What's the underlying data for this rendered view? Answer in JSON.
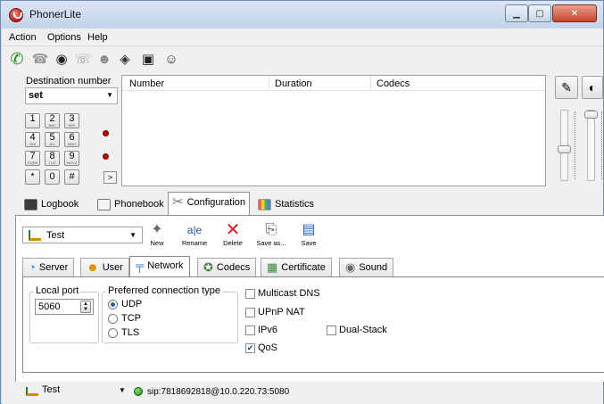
{
  "window": {
    "title": "PhonerLite"
  },
  "menu": [
    "Action",
    "Options",
    "Help"
  ],
  "toolbar": [
    {
      "icon": "call-green-handset-icon",
      "glyph": "✆",
      "color": "#1c8a1c"
    },
    {
      "icon": "hangup-handset-icon",
      "glyph": "☎",
      "color": "#9a9a9a"
    },
    {
      "icon": "voicemail-icon",
      "glyph": "◉",
      "color": "#222"
    },
    {
      "icon": "transfer-handset-icon",
      "glyph": "☏",
      "color": "#9a9a9a"
    },
    {
      "icon": "conference-users-icon",
      "glyph": "☻",
      "color": "#888"
    },
    {
      "icon": "redirect-diamond-icon",
      "glyph": "◈",
      "color": "#333"
    },
    {
      "icon": "mobile-phone-icon",
      "glyph": "▣",
      "color": "#222"
    },
    {
      "icon": "smiley-icon",
      "glyph": "☺",
      "color": "#333"
    }
  ],
  "dialer": {
    "destination_label": "Destination number",
    "destination_value": "set",
    "keys": [
      {
        "d": "1",
        "l": ""
      },
      {
        "d": "2",
        "l": "ABC"
      },
      {
        "d": "3",
        "l": "DEF"
      },
      {
        "d": "4",
        "l": "GHI"
      },
      {
        "d": "5",
        "l": "JKL"
      },
      {
        "d": "6",
        "l": "MNO"
      },
      {
        "d": "7",
        "l": "PQRS"
      },
      {
        "d": "8",
        "l": "TUV"
      },
      {
        "d": "9",
        "l": "WXYZ"
      },
      {
        "d": "*",
        "l": ""
      },
      {
        "d": "0",
        "l": ""
      },
      {
        "d": "#",
        "l": ""
      }
    ],
    "expand_label": ">"
  },
  "calllist": {
    "columns": [
      "Number",
      "Duration",
      "Codecs"
    ]
  },
  "main_tabs": [
    {
      "label": "Logbook",
      "icon": "logbook-icon"
    },
    {
      "label": "Phonebook",
      "icon": "phonebook-icon"
    },
    {
      "label": "Configuration",
      "icon": "tools-icon",
      "active": true
    },
    {
      "label": "Statistics",
      "icon": "statistics-icon"
    }
  ],
  "profile": {
    "selected": "Test",
    "buttons": [
      {
        "label": "New",
        "icon": "wand-icon",
        "glyph": "✦"
      },
      {
        "label": "Rename",
        "icon": "rename-icon",
        "glyph": "a|e"
      },
      {
        "label": "Delete",
        "icon": "delete-x-icon",
        "glyph": "✕"
      },
      {
        "label": "Save as...",
        "icon": "save-as-icon",
        "glyph": "⎘"
      },
      {
        "label": "Save",
        "icon": "save-disk-icon",
        "glyph": "▤"
      }
    ]
  },
  "config_tabs": [
    {
      "label": "Server",
      "icon": "server-icon"
    },
    {
      "label": "User",
      "icon": "user-icon"
    },
    {
      "label": "Network",
      "icon": "network-icon",
      "active": true
    },
    {
      "label": "Codecs",
      "icon": "codecs-icon"
    },
    {
      "label": "Certificate",
      "icon": "certificate-icon"
    },
    {
      "label": "Sound",
      "icon": "sound-icon"
    }
  ],
  "network": {
    "local_port_label": "Local port",
    "local_port_value": "5060",
    "conn_type_label": "Preferred connection type",
    "conn_types": [
      {
        "label": "UDP",
        "selected": true
      },
      {
        "label": "TCP",
        "selected": false
      },
      {
        "label": "TLS",
        "selected": false
      }
    ],
    "options": [
      {
        "label": "Multicast DNS",
        "checked": false
      },
      {
        "label": "UPnP NAT",
        "checked": false
      },
      {
        "label": "IPv6",
        "checked": false
      },
      {
        "label": "QoS",
        "checked": true
      },
      {
        "label": "Dual-Stack",
        "checked": false
      }
    ]
  },
  "status": {
    "profile": "Test",
    "sip": "sip:7818692818@10.0.220.73:5080"
  }
}
